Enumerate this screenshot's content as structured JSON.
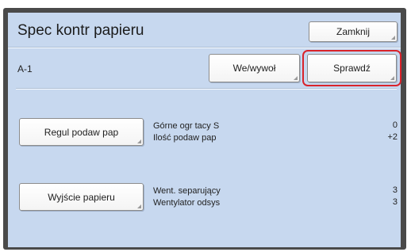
{
  "header": {
    "title": "Spec kontr papieru",
    "close_label": "Zamknij"
  },
  "toolbar": {
    "id_label": "A-1",
    "io_label": "We/wywoł",
    "check_label": "Sprawdź"
  },
  "sections": [
    {
      "button_label": "Regul podaw pap",
      "rows": [
        {
          "label": "Górne ogr tacy S",
          "value": "0"
        },
        {
          "label": "Ilość podaw pap",
          "value": "+2"
        }
      ]
    },
    {
      "button_label": "Wyjście papieru",
      "rows": [
        {
          "label": "Went. separujący",
          "value": "3"
        },
        {
          "label": "Wentylator odsys",
          "value": "3"
        }
      ]
    }
  ],
  "colors": {
    "panel_bg": "#c7d8ef",
    "highlight": "#d9232a"
  }
}
